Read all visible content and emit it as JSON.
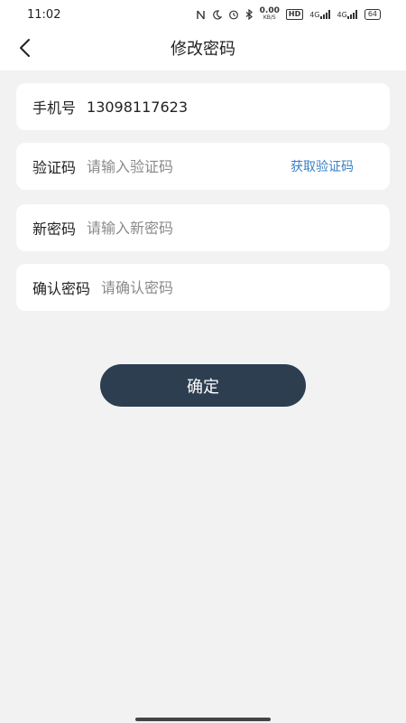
{
  "status_bar": {
    "time": "11:02",
    "net_speed_value": "0.00",
    "net_speed_unit": "KB/S",
    "hd_label": "HD",
    "signal_1": "4G",
    "signal_2": "4G",
    "battery": "64",
    "icons": [
      "nfc-icon",
      "moon-icon",
      "alarm-icon",
      "bluetooth-icon",
      "wifi-signal-icon"
    ]
  },
  "header": {
    "title": "修改密码",
    "back_icon": "chevron-left-icon"
  },
  "form": {
    "phone": {
      "label": "手机号",
      "value": "13098117623"
    },
    "verify_code": {
      "label": "验证码",
      "placeholder": "请输入验证码",
      "action": "获取验证码"
    },
    "new_password": {
      "label": "新密码",
      "placeholder": "请输入新密码"
    },
    "confirm_password": {
      "label": "确认密码",
      "placeholder": "请确认密码"
    }
  },
  "submit": {
    "label": "确定"
  },
  "colors": {
    "accent_link": "#3b7fc4",
    "button_bg": "#2d3e50",
    "page_bg": "#f2f2f2"
  }
}
